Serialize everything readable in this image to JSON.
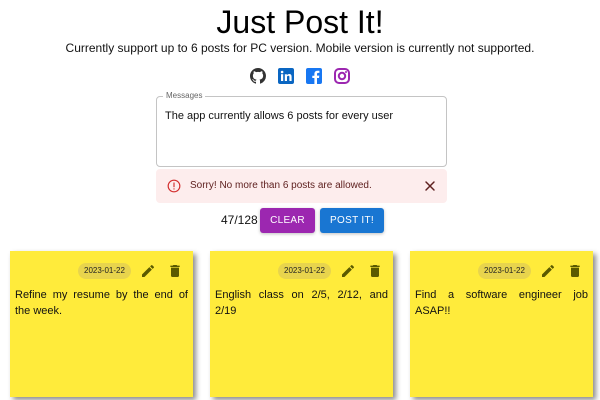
{
  "header": {
    "title": "Just Post It!",
    "subtitle": "Currently support up to 6 posts for PC version. Mobile version is currently not supported."
  },
  "social": [
    {
      "icon": "github-icon",
      "color": "#333333"
    },
    {
      "icon": "linkedin-icon",
      "color": "#0a66c2"
    },
    {
      "icon": "facebook-icon",
      "color": "#1877f2"
    },
    {
      "icon": "instagram-icon",
      "color": "#9c27b0"
    }
  ],
  "editor": {
    "label": "Messages",
    "value": "The app currently allows 6 posts for every user"
  },
  "alert": {
    "text": "Sorry! No more than 6 posts are allowed.",
    "icon": "error-outline-icon",
    "color": "#d32f2f",
    "background": "#fdeded"
  },
  "controls": {
    "counter": "47/128",
    "clear_label": "CLEAR",
    "post_label": "POST IT!",
    "clear_color": "#9c27b0",
    "post_color": "#1976d2"
  },
  "notes": [
    {
      "date": "2023-01-22",
      "text": "Refine my resume by the end of the week."
    },
    {
      "date": "2023-01-22",
      "text": "English class on 2/5, 2/12, and 2/19"
    },
    {
      "date": "2023-01-22",
      "text": "Find a software engineer job ASAP!!"
    }
  ],
  "colors": {
    "note_background": "#ffeb3b",
    "note_icons": "#5a5a00"
  }
}
